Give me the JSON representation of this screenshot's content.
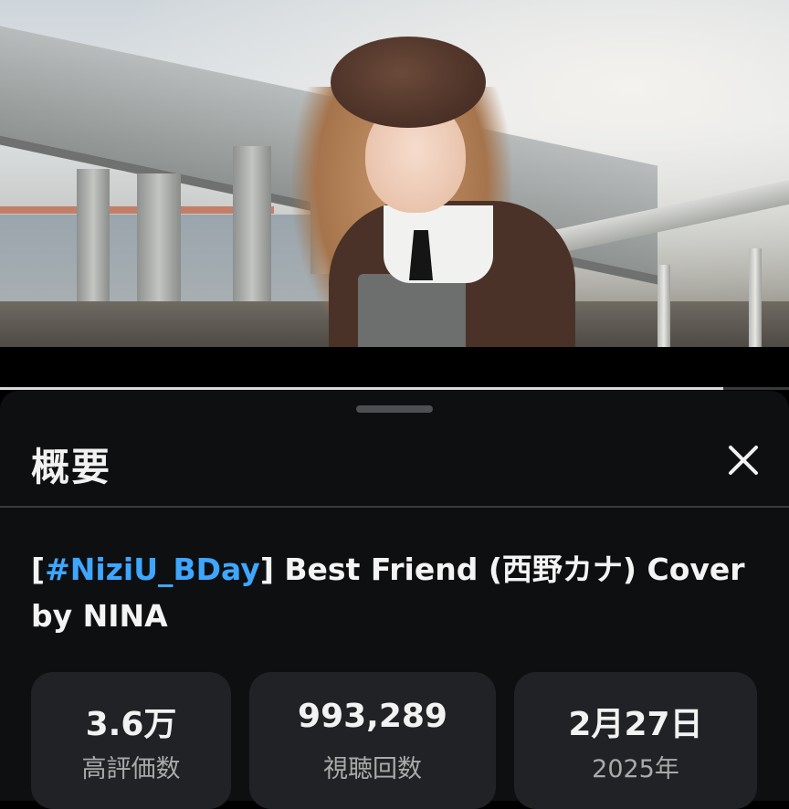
{
  "player": {
    "progress_fraction": 0.917
  },
  "sheet": {
    "title": "概要",
    "close_icon": "close-icon",
    "video_title_hashtag": "#NiziU_BDay",
    "video_title_open": "[",
    "video_title_close": "]",
    "video_title_rest": " Best Friend (西野カナ) Cover by NINA",
    "link_color": "#3ea6ff"
  },
  "stats": [
    {
      "value": "3.6万",
      "label": "高評価数"
    },
    {
      "value": "993,289",
      "label": "視聴回数"
    },
    {
      "value": "2月27日",
      "label": "2025年"
    }
  ]
}
